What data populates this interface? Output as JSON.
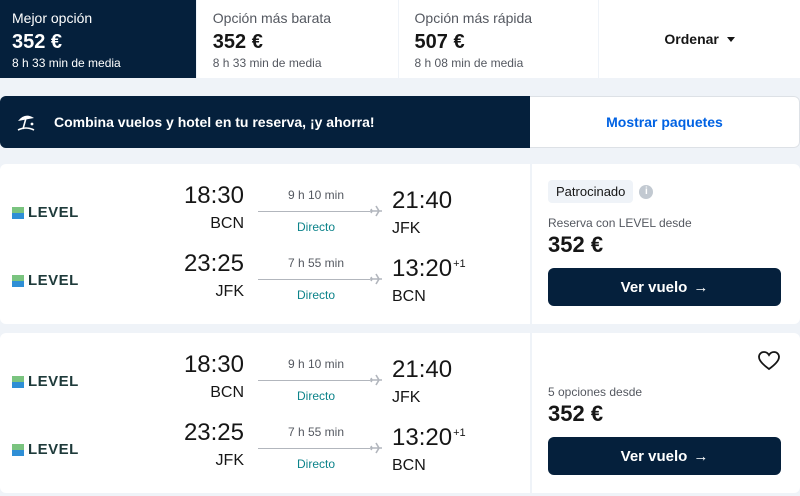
{
  "sort_tabs": [
    {
      "label": "Mejor opción",
      "price": "352 €",
      "sub": "8 h 33 min de media"
    },
    {
      "label": "Opción más barata",
      "price": "352 €",
      "sub": "8 h 33 min de media"
    },
    {
      "label": "Opción más rápida",
      "price": "507 €",
      "sub": "8 h 08 min de media"
    }
  ],
  "sort_menu": {
    "label": "Ordenar"
  },
  "banner": {
    "text": "Combina vuelos y hotel en tu reserva, ¡y ahorra!",
    "link": "Mostrar paquetes",
    "icon": "beach-umbrella-icon"
  },
  "results": [
    {
      "legs": [
        {
          "airline": "LEVEL",
          "dep_time": "18:30",
          "dep_code": "BCN",
          "duration": "9 h 10 min",
          "stops": "Directo",
          "arr_time": "21:40",
          "arr_code": "JFK",
          "plus": ""
        },
        {
          "airline": "LEVEL",
          "dep_time": "23:25",
          "dep_code": "JFK",
          "duration": "7 h 55 min",
          "stops": "Directo",
          "arr_time": "13:20",
          "arr_code": "BCN",
          "plus": "+1"
        }
      ],
      "badge": "Patrocinado",
      "from_text": "Reserva con LEVEL desde",
      "price": "352 €",
      "cta": "Ver vuelo"
    },
    {
      "legs": [
        {
          "airline": "LEVEL",
          "dep_time": "18:30",
          "dep_code": "BCN",
          "duration": "9 h 10 min",
          "stops": "Directo",
          "arr_time": "21:40",
          "arr_code": "JFK",
          "plus": ""
        },
        {
          "airline": "LEVEL",
          "dep_time": "23:25",
          "dep_code": "JFK",
          "duration": "7 h 55 min",
          "stops": "Directo",
          "arr_time": "13:20",
          "arr_code": "BCN",
          "plus": "+1"
        }
      ],
      "from_text": "5 opciones desde",
      "price": "352 €",
      "cta": "Ver vuelo"
    }
  ],
  "colors": {
    "navy": "#05203c",
    "link_blue": "#0062e3",
    "direct_teal": "#0c838a",
    "background": "#eff3f8"
  }
}
